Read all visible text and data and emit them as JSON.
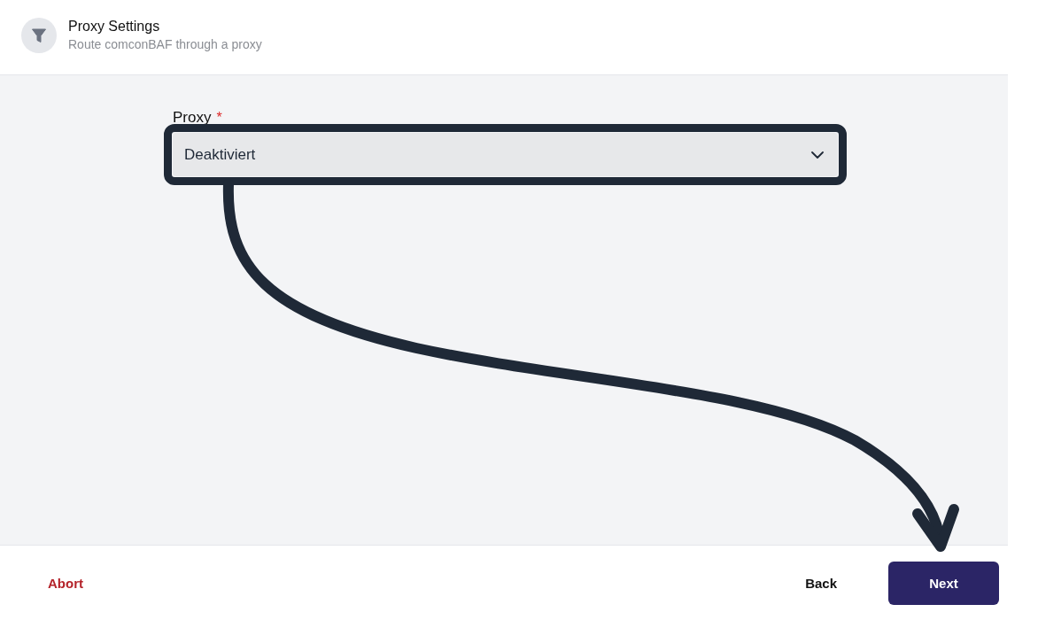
{
  "header": {
    "title": "Proxy Settings",
    "subtitle": "Route comconBAF through a proxy"
  },
  "form": {
    "fields": [
      {
        "kind": "select",
        "label": "Proxy",
        "required_mark": "*",
        "value": "Deaktiviert",
        "highlighted": true
      }
    ]
  },
  "footer": {
    "buttons": [
      {
        "kind": "danger",
        "label": "Abort"
      },
      {
        "kind": "secondary",
        "label": "Back"
      },
      {
        "kind": "primary",
        "label": "Next"
      }
    ]
  }
}
